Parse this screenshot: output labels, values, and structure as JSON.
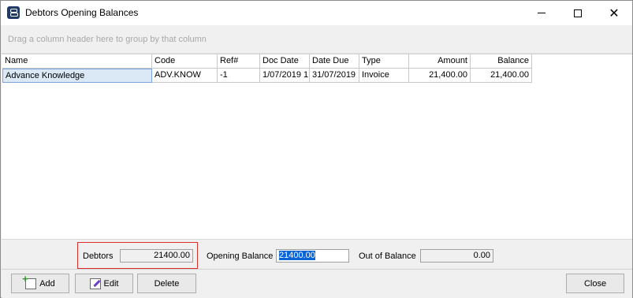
{
  "window": {
    "title": "Debtors Opening Balances",
    "minimize_icon": "minimize-icon",
    "maximize_icon": "maximize-icon",
    "close_glyph": "✕"
  },
  "group_panel": {
    "hint": "Drag a column header here to group by that column"
  },
  "grid": {
    "columns": [
      "Name",
      "Code",
      "Ref#",
      "Doc Date",
      "Date Due",
      "Type",
      "Amount",
      "Balance"
    ],
    "rows": [
      [
        "Advance Knowledge",
        "ADV.KNOW",
        "-1",
        "1/07/2019 1",
        "31/07/2019",
        "Invoice",
        "21,400.00",
        "21,400.00"
      ]
    ]
  },
  "totals": {
    "debtors_label": "Debtors",
    "debtors_value": "21400.00",
    "opening_label": "Opening Balance",
    "opening_value": "21400.00",
    "out_label": "Out of Balance",
    "out_value": "0.00",
    "highlight_color": "#d9302b"
  },
  "buttons": {
    "add": "Add",
    "edit": "Edit",
    "delete": "Delete",
    "close": "Close"
  }
}
